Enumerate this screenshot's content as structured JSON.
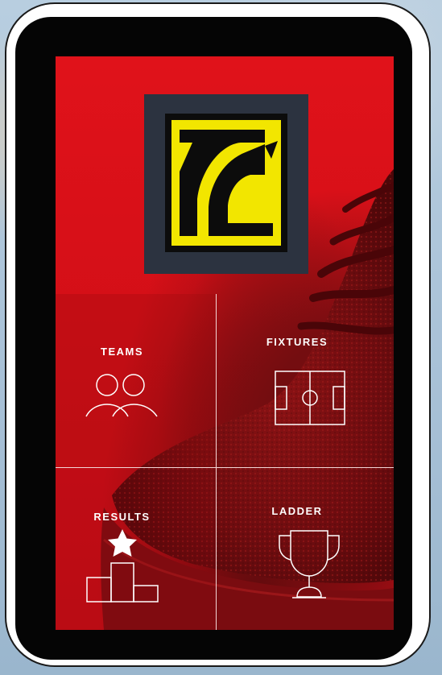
{
  "menu": {
    "teams": "TEAMS",
    "fixtures": "FIXTURES",
    "results": "RESULTS",
    "ladder": "LADDER"
  },
  "icons": {
    "teams": "people-icon",
    "fixtures": "pitch-icon",
    "results": "podium-star-icon",
    "ladder": "trophy-icon",
    "logo": "club-logo"
  },
  "colors": {
    "screen_red": "#d40f17",
    "logo_yellow": "#f2e600",
    "logo_frame": "#2c3340",
    "divider": "#f3d6d6"
  }
}
